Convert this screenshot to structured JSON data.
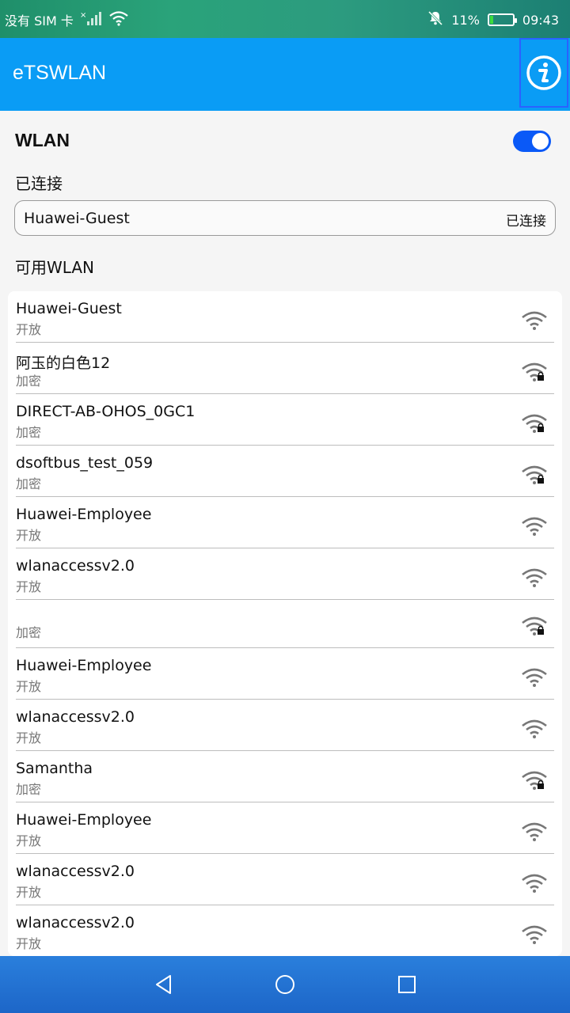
{
  "status_bar": {
    "carrier": "没有 SIM 卡",
    "battery": "11%",
    "battery_level": 0.11,
    "time": "09:43"
  },
  "app_bar": {
    "title": "eTSWLAN",
    "info_icon": "info-icon"
  },
  "wlan": {
    "label": "WLAN",
    "enabled": true
  },
  "connected_section": {
    "label": "已连接",
    "network_name": "Huawei-Guest",
    "status": "已连接"
  },
  "available_section": {
    "label": "可用WLAN"
  },
  "networks": [
    {
      "name": "Huawei-Guest",
      "security": "开放",
      "locked": false
    },
    {
      "name": "阿玉的白色12",
      "security": "加密",
      "locked": true
    },
    {
      "name": "DIRECT-AB-OHOS_0GC1",
      "security": "加密",
      "locked": true
    },
    {
      "name": "dsoftbus_test_059",
      "security": "加密",
      "locked": true
    },
    {
      "name": "Huawei-Employee",
      "security": "开放",
      "locked": false
    },
    {
      "name": "wlanaccessv2.0",
      "security": "开放",
      "locked": false
    },
    {
      "name": "",
      "security": "加密",
      "locked": true
    },
    {
      "name": "Huawei-Employee",
      "security": "开放",
      "locked": false
    },
    {
      "name": "wlanaccessv2.0",
      "security": "开放",
      "locked": false
    },
    {
      "name": "Samantha",
      "security": "加密",
      "locked": true
    },
    {
      "name": "Huawei-Employee",
      "security": "开放",
      "locked": false
    },
    {
      "name": "wlanaccessv2.0",
      "security": "开放",
      "locked": false
    },
    {
      "name": "wlanaccessv2.0",
      "security": "开放",
      "locked": false
    }
  ],
  "nav_bar": {
    "back_icon": "back-icon",
    "home_icon": "home-icon",
    "recents_icon": "recents-icon"
  },
  "colors": {
    "app_bar": "#0a9cf5",
    "toggle_on": "#0a59f7"
  }
}
